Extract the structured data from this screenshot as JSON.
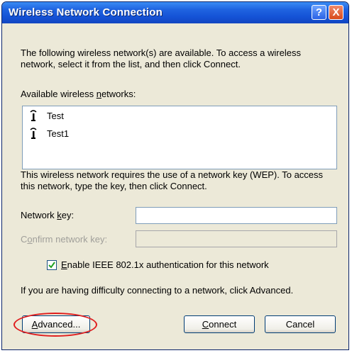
{
  "window": {
    "title": "Wireless Network Connection",
    "help_symbol": "?",
    "close_symbol": "X"
  },
  "intro_text": "The following wireless network(s) are available. To access a wireless network, select it from the list, and then click Connect.",
  "available_label": "Available wireless networks:",
  "networks": [
    {
      "name": "Test"
    },
    {
      "name": "Test1"
    }
  ],
  "wep_text": "This wireless network requires the use of a network key (WEP). To access this network, type the key, then click Connect.",
  "network_key": {
    "label": "Network key:",
    "value": ""
  },
  "confirm_key": {
    "label": "Confirm network key:",
    "value": ""
  },
  "ieee_checkbox": {
    "label": "Enable IEEE 802.1x authentication for this network",
    "checked": true
  },
  "difficulty_text": "If you are having difficulty connecting to a network, click Advanced.",
  "buttons": {
    "advanced": "Advanced...",
    "connect": "Connect",
    "cancel": "Cancel"
  },
  "colors": {
    "titlebar": "#1f63e0",
    "highlight": "#e01e1e"
  }
}
